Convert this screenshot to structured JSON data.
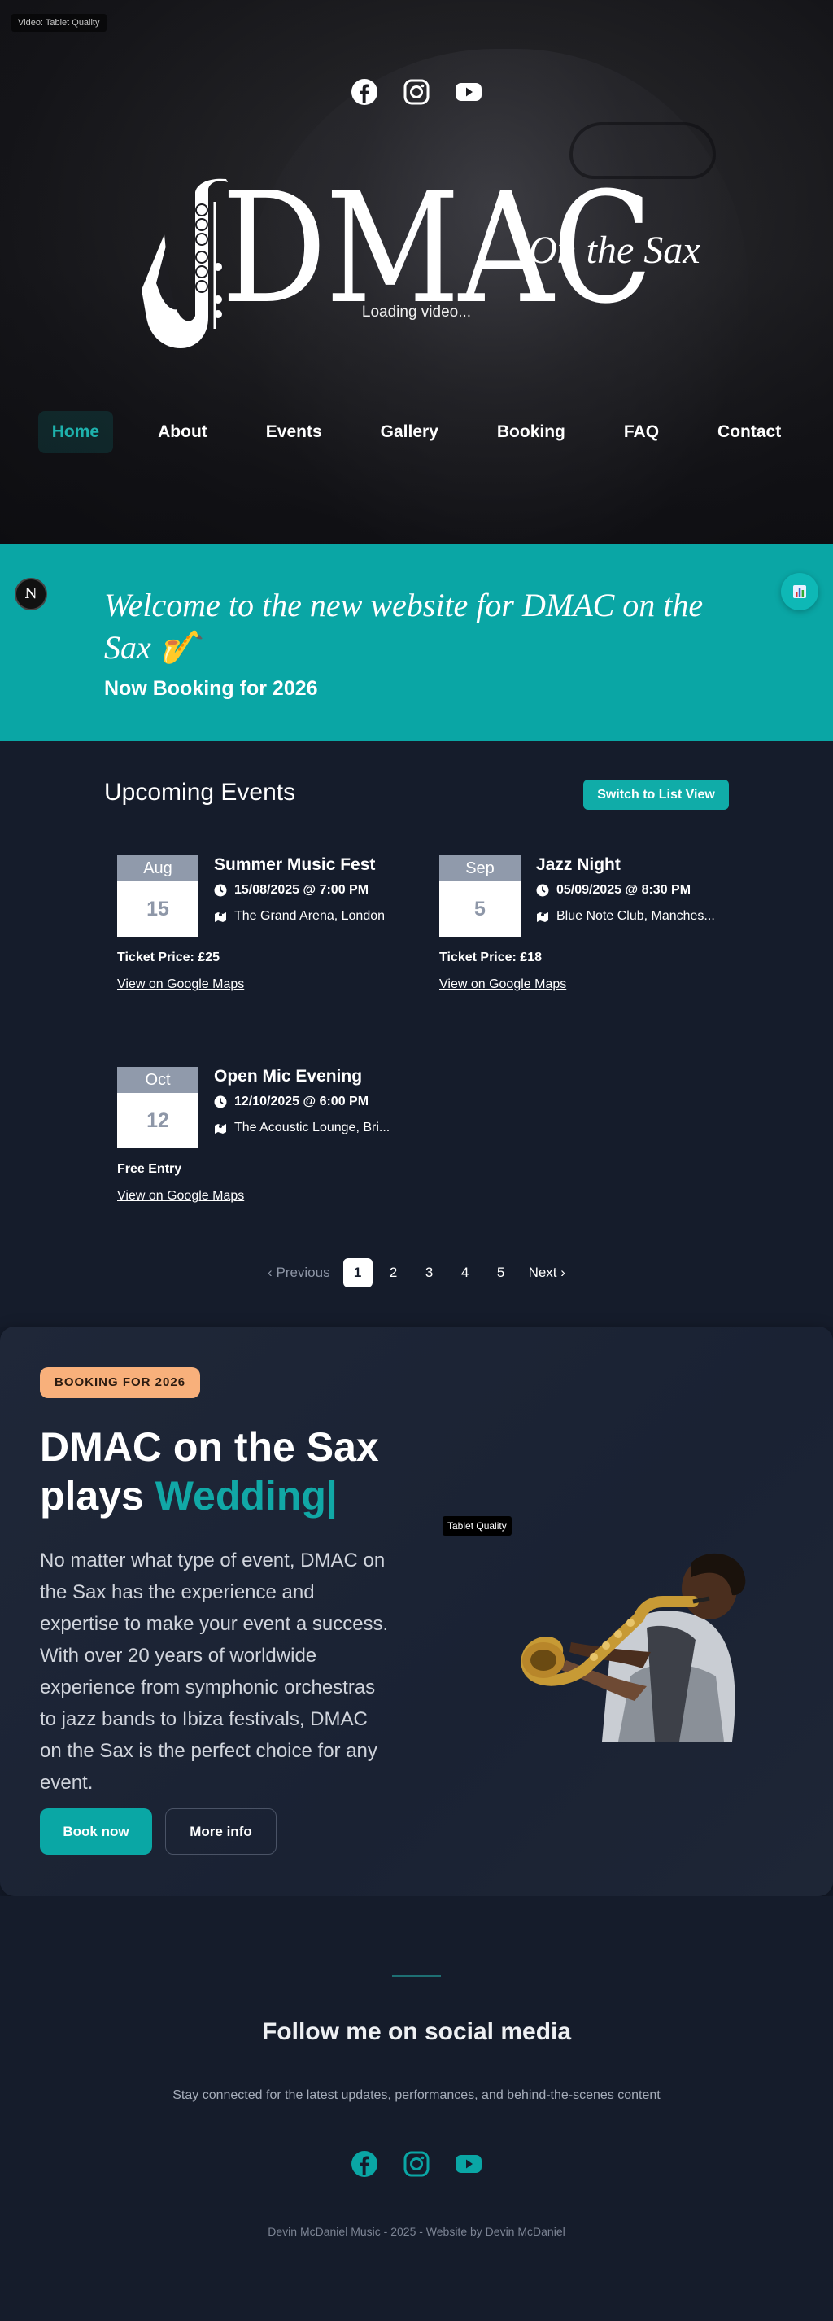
{
  "video_badge": "Video: Tablet Quality",
  "hero": {
    "social": [
      "facebook-icon",
      "instagram-icon",
      "youtube-icon"
    ],
    "logo_main": "DMAC",
    "logo_sub": "On the Sax",
    "loading": "Loading video..."
  },
  "nav": {
    "items": [
      {
        "label": "Home",
        "active": true
      },
      {
        "label": "About"
      },
      {
        "label": "Events"
      },
      {
        "label": "Gallery"
      },
      {
        "label": "Booking"
      },
      {
        "label": "FAQ"
      },
      {
        "label": "Contact"
      }
    ]
  },
  "welcome": {
    "avatar": "N",
    "title": "Welcome to the new website for DMAC on the Sax 🎷",
    "subtitle": "Now Booking for 2026"
  },
  "events": {
    "title": "Upcoming Events",
    "switch_label": "Switch to List View",
    "items": [
      {
        "month": "Aug",
        "day": "15",
        "name": "Summer Music Fest",
        "datetime": "15/08/2025 @ 7:00 PM",
        "venue": "The Grand Arena, London",
        "price": "Ticket Price: £25",
        "maps": "View on Google Maps"
      },
      {
        "month": "Sep",
        "day": "5",
        "name": "Jazz Night",
        "datetime": "05/09/2025 @ 8:30 PM",
        "venue": "Blue Note Club, Manches...",
        "price": "Ticket Price: £18",
        "maps": "View on Google Maps"
      },
      {
        "month": "Oct",
        "day": "12",
        "name": "Open Mic Evening",
        "datetime": "12/10/2025 @ 6:00 PM",
        "venue": "The Acoustic Lounge, Bri...",
        "price": "Free Entry",
        "maps": "View on Google Maps"
      }
    ],
    "pager": {
      "prev": "Previous",
      "pages": [
        "1",
        "2",
        "3",
        "4",
        "5"
      ],
      "current": "1",
      "next": "Next"
    }
  },
  "booking": {
    "badge": "BOOKING FOR 2026",
    "heading_line1": "DMAC on the Sax",
    "heading_plays": "plays ",
    "heading_highlight": "Wedding|",
    "paragraph": "No matter what type of event, DMAC on the Sax has the experience and expertise to make your event a success. With over 20 years of worldwide experience from symphonic orchestras to jazz bands to Ibiza festivals, DMAC on the Sax is the perfect choice for any event.",
    "book_label": "Book now",
    "more_label": "More info",
    "image_badge": "Tablet Quality"
  },
  "footer": {
    "heading": "Follow me on social media",
    "sub": "Stay connected for the latest updates, performances, and behind-the-scenes content",
    "social": [
      "facebook-icon",
      "instagram-icon",
      "youtube-icon"
    ],
    "copyright": "Devin McDaniel Music - 2025 - Website by Devin McDaniel"
  },
  "colors": {
    "accent": "#0aa6a5",
    "badge": "#f8b07b",
    "bg": "#151c2b"
  }
}
